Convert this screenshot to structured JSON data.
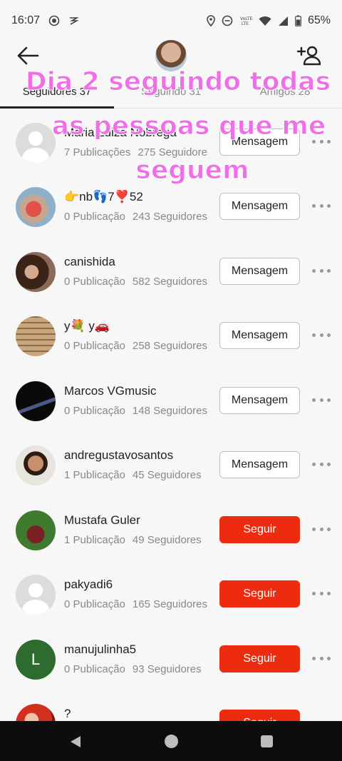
{
  "status_bar": {
    "time": "16:07",
    "battery": "65%"
  },
  "tabs": [
    {
      "label": "Seguidores",
      "count": "37"
    },
    {
      "label": "Seguindo",
      "count": "31"
    },
    {
      "label": "Amigos",
      "count": "28"
    }
  ],
  "overlay": {
    "line1": "Dia 2 seguindo todas",
    "line2": "as pessoas que me",
    "line3": "seguem"
  },
  "users": [
    {
      "name": "Maria Luiza Nobrega",
      "posts": "7 Publicações",
      "followers": "275 Seguidores",
      "button": "Mensagem"
    },
    {
      "name": "👉nb👣7❣️52",
      "posts": "0 Publicação",
      "followers": "243 Seguidores",
      "button": "Mensagem"
    },
    {
      "name": "canishida",
      "posts": "0 Publicação",
      "followers": "582 Seguidores",
      "button": "Mensagem"
    },
    {
      "name": "y💐 y🚗",
      "posts": "0 Publicação",
      "followers": "258 Seguidores",
      "button": "Mensagem"
    },
    {
      "name": "Marcos VGmusic",
      "posts": "0 Publicação",
      "followers": "148 Seguidores",
      "button": "Mensagem"
    },
    {
      "name": "andregustavosantos",
      "posts": "1 Publicação",
      "followers": "45 Seguidores",
      "button": "Mensagem"
    },
    {
      "name": "Mustafa Guler",
      "posts": "1 Publicação",
      "followers": "49 Seguidores",
      "button": "Seguir"
    },
    {
      "name": "pakyadi6",
      "posts": "0 Publicação",
      "followers": "165 Seguidores",
      "button": "Seguir"
    },
    {
      "name": "manujulinha5",
      "posts": "0 Publicação",
      "followers": "93 Seguidores",
      "button": "Seguir",
      "avatar_letter": "L"
    },
    {
      "name": "?",
      "posts": "",
      "followers": "",
      "button": "Seguir"
    }
  ],
  "colors": {
    "follow_button": "#ec2b0f",
    "overlay_text": "#f06ee8",
    "letter_avatar": "#2e6b2e"
  }
}
